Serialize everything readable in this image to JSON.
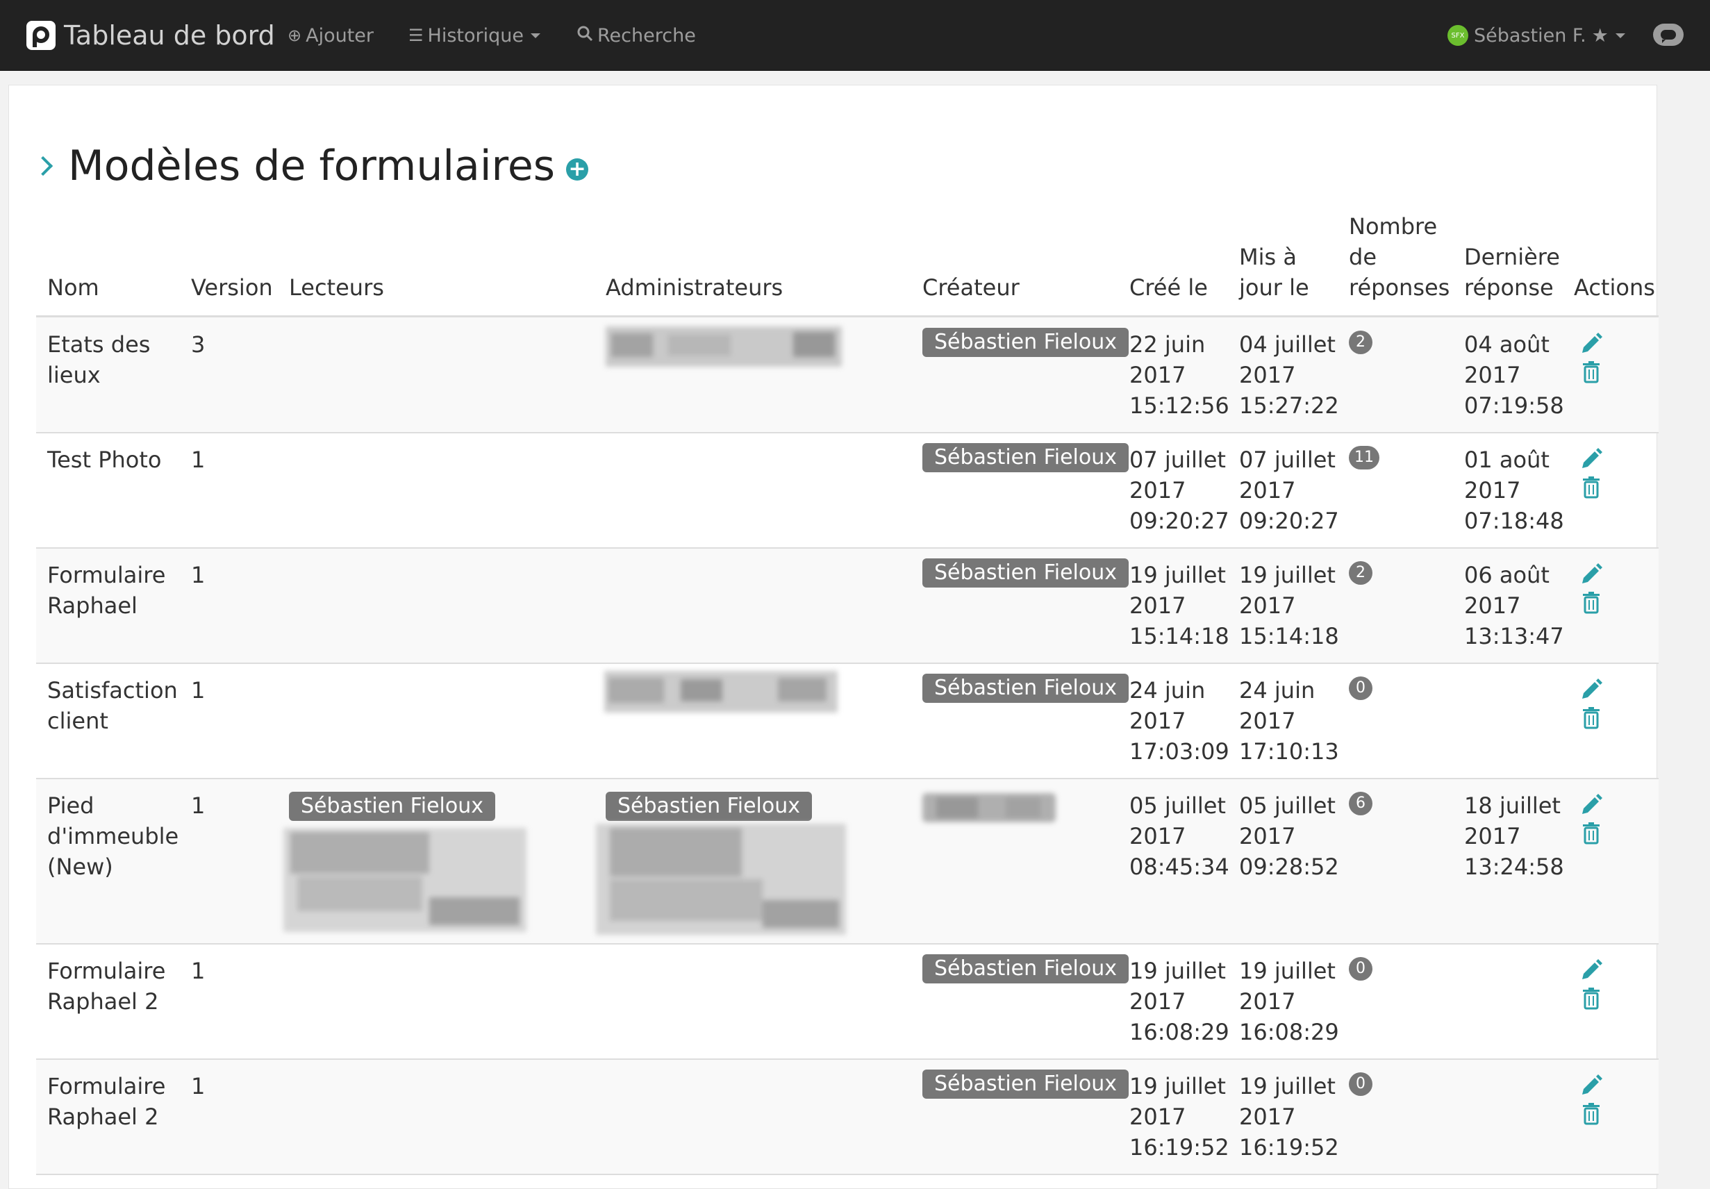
{
  "navbar": {
    "brand": "Tableau de bord",
    "add": "Ajouter",
    "history": "Historique",
    "search": "Recherche",
    "avatar_initials": "SFX",
    "user": "Sébastien F."
  },
  "page": {
    "title": "Modèles de formulaires"
  },
  "table": {
    "headers": {
      "nom": "Nom",
      "version": "Version",
      "lecteurs": "Lecteurs",
      "administrateurs": "Administrateurs",
      "createur": "Créateur",
      "cree_l1": "Créé le",
      "maj_l1": "Mis à",
      "maj_l2": "jour le",
      "nombre_l1": "Nombre",
      "nombre_l2": "de",
      "nombre_l3": "réponses",
      "derniere_l1": "Dernière",
      "derniere_l2": "réponse",
      "actions": "Actions"
    },
    "rows": [
      {
        "name": [
          "Etats des",
          "lieux"
        ],
        "version": "3",
        "readers": "",
        "admins": "",
        "creator": "Sébastien Fieloux",
        "created": [
          "22 juin",
          "2017",
          "15:12:56"
        ],
        "updated": [
          "04 juillet",
          "2017",
          "15:27:22"
        ],
        "responses": "2",
        "last": [
          "04 août",
          "2017",
          "07:19:58"
        ]
      },
      {
        "name": [
          "Test Photo",
          ""
        ],
        "version": "1",
        "readers": "",
        "admins": "",
        "creator": "Sébastien Fieloux",
        "created": [
          "07 juillet",
          "2017",
          "09:20:27"
        ],
        "updated": [
          "07 juillet",
          "2017",
          "09:20:27"
        ],
        "responses": "11",
        "last": [
          "01 août",
          "2017",
          "07:18:48"
        ]
      },
      {
        "name": [
          "Formulaire",
          "Raphael"
        ],
        "version": "1",
        "readers": "",
        "admins": "",
        "creator": "Sébastien Fieloux",
        "created": [
          "19 juillet",
          "2017",
          "15:14:18"
        ],
        "updated": [
          "19 juillet",
          "2017",
          "15:14:18"
        ],
        "responses": "2",
        "last": [
          "06 août",
          "2017",
          "13:13:47"
        ]
      },
      {
        "name": [
          "Satisfaction",
          "client"
        ],
        "version": "1",
        "readers": "",
        "admins": "",
        "creator": "Sébastien Fieloux",
        "created": [
          "24 juin",
          "2017",
          "17:03:09"
        ],
        "updated": [
          "24 juin",
          "2017",
          "17:10:13"
        ],
        "responses": "0",
        "last": [
          "",
          "",
          ""
        ]
      },
      {
        "name": [
          "Pied",
          "d'immeuble",
          "(New)"
        ],
        "version": "1",
        "readers": "Sébastien Fieloux",
        "admins": "Sébastien Fieloux",
        "creator": "",
        "created": [
          "05 juillet",
          "2017",
          "08:45:34"
        ],
        "updated": [
          "05 juillet",
          "2017",
          "09:28:52"
        ],
        "responses": "6",
        "last": [
          "18 juillet",
          "2017",
          "13:24:58"
        ]
      },
      {
        "name": [
          "Formulaire",
          "Raphael 2"
        ],
        "version": "1",
        "readers": "",
        "admins": "",
        "creator": "Sébastien Fieloux",
        "created": [
          "19 juillet",
          "2017",
          "16:08:29"
        ],
        "updated": [
          "19 juillet",
          "2017",
          "16:08:29"
        ],
        "responses": "0",
        "last": [
          "",
          "",
          ""
        ]
      },
      {
        "name": [
          "Formulaire",
          "Raphael 2"
        ],
        "version": "1",
        "readers": "",
        "admins": "",
        "creator": "Sébastien Fieloux",
        "created": [
          "19 juillet",
          "2017",
          "16:19:52"
        ],
        "updated": [
          "19 juillet",
          "2017",
          "16:19:52"
        ],
        "responses": "0",
        "last": [
          "",
          "",
          ""
        ]
      }
    ]
  },
  "icons": {
    "edit": "pencil-icon",
    "delete": "trash-icon",
    "add": "plus-circle-icon"
  },
  "colors": {
    "accent": "#2a9fa8",
    "navbar": "#222222",
    "label": "#777777"
  }
}
